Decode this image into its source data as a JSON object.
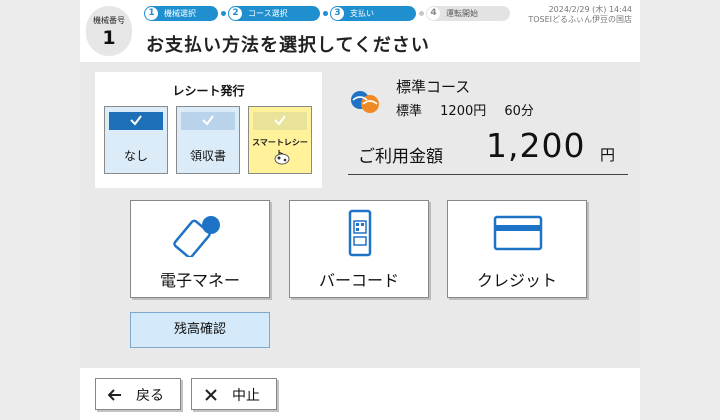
{
  "header": {
    "machine_label": "機械番号",
    "machine_number": "1",
    "steps": [
      {
        "num": "1",
        "label": "機械選択"
      },
      {
        "num": "2",
        "label": "コース選択"
      },
      {
        "num": "3",
        "label": "支払い"
      },
      {
        "num": "4",
        "label": "運転開始"
      }
    ],
    "datetime": "2024/2/29 (木) 14:44",
    "store": "TOSEIどるふぃん伊豆の国店",
    "title": "お支払い方法を選択してください"
  },
  "receipt": {
    "title": "レシート発行",
    "options": [
      "なし",
      "領収書",
      "スマートレシート"
    ]
  },
  "course": {
    "name": "標準コース",
    "detail_name": "標準",
    "detail_price": "1200円",
    "detail_time": "60分",
    "amount_label": "ご利用金額",
    "amount": "1,200",
    "unit": "円"
  },
  "payment": {
    "emoney": "電子マネー",
    "barcode": "バーコード",
    "credit": "クレジット",
    "balance": "残高確認"
  },
  "footer": {
    "back": "戻る",
    "cancel": "中止"
  },
  "colors": {
    "accent": "#1f8fd0",
    "selected": "#1d6fb8",
    "smart_receipt": "#fff29a"
  }
}
